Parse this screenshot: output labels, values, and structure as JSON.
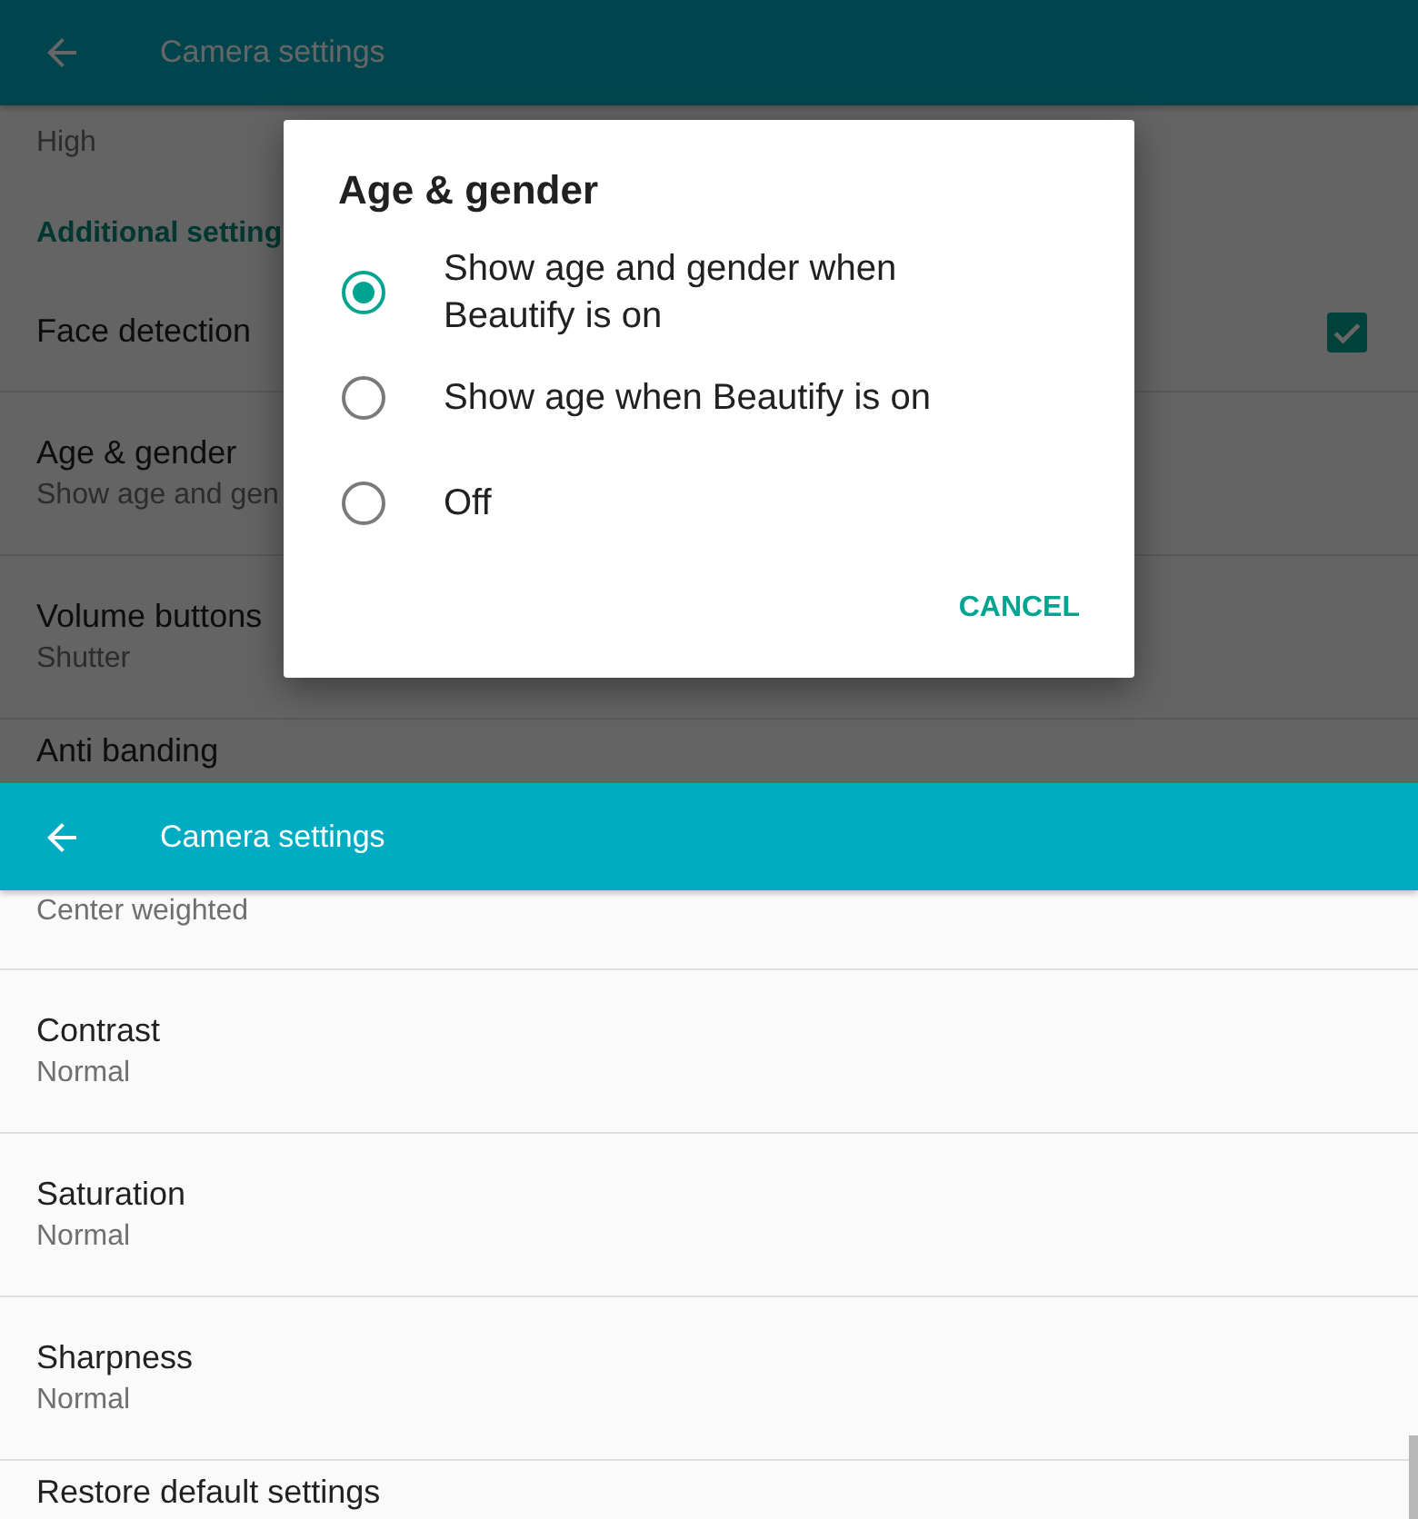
{
  "top_screen": {
    "header": {
      "title": "Camera settings"
    },
    "items": [
      {
        "kind": "pref",
        "summary": "High"
      },
      {
        "kind": "category",
        "title": "Additional setting"
      },
      {
        "kind": "checkbox",
        "title": "Face detection",
        "checked": true
      },
      {
        "kind": "pref",
        "title": "Age & gender",
        "summary": "Show age and gen"
      },
      {
        "kind": "pref",
        "title": "Volume buttons",
        "summary": "Shutter"
      },
      {
        "kind": "action",
        "title": "Anti banding"
      }
    ],
    "dialog": {
      "title": "Age & gender",
      "options": [
        {
          "label": "Show age and gender when Beautify is on",
          "selected": true
        },
        {
          "label": "Show age when Beautify is on",
          "selected": false
        },
        {
          "label": "Off",
          "selected": false
        }
      ],
      "button": "CANCEL"
    }
  },
  "bottom_screen": {
    "header": {
      "title": "Camera settings"
    },
    "items": [
      {
        "kind": "pref",
        "summary": "Center weighted"
      },
      {
        "kind": "pref",
        "title": "Contrast",
        "summary": "Normal"
      },
      {
        "kind": "pref",
        "title": "Saturation",
        "summary": "Normal"
      },
      {
        "kind": "pref",
        "title": "Sharpness",
        "summary": "Normal"
      },
      {
        "kind": "action",
        "title": "Restore default settings"
      }
    ]
  }
}
